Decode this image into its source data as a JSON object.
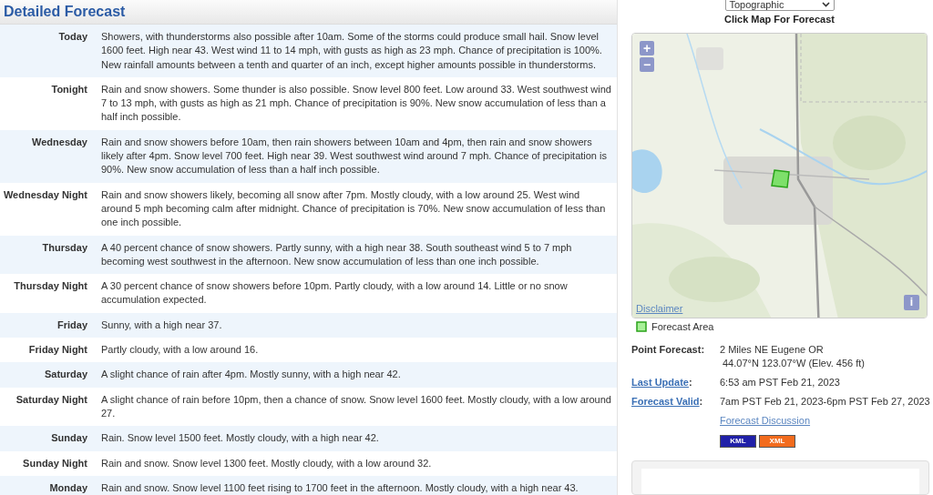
{
  "header": {
    "title": "Detailed Forecast"
  },
  "periods": [
    {
      "name": "Today",
      "text": "Showers, with thunderstorms also possible after 10am. Some of the storms could produce small hail. Snow level 1600 feet. High near 43. West wind 11 to 14 mph, with gusts as high as 23 mph. Chance of precipitation is 100%. New rainfall amounts between a tenth and quarter of an inch, except higher amounts possible in thunderstorms."
    },
    {
      "name": "Tonight",
      "text": "Rain and snow showers. Some thunder is also possible. Snow level 800 feet. Low around 33. West southwest wind 7 to 13 mph, with gusts as high as 21 mph. Chance of precipitation is 90%. New snow accumulation of less than a half inch possible."
    },
    {
      "name": "Wednesday",
      "text": "Rain and snow showers before 10am, then rain showers between 10am and 4pm, then rain and snow showers likely after 4pm. Snow level 700 feet. High near 39. West southwest wind around 7 mph. Chance of precipitation is 90%. New snow accumulation of less than a half inch possible."
    },
    {
      "name": "Wednesday Night",
      "text": "Rain and snow showers likely, becoming all snow after 7pm. Mostly cloudy, with a low around 25. West wind around 5 mph becoming calm after midnight. Chance of precipitation is 70%. New snow accumulation of less than one inch possible."
    },
    {
      "name": "Thursday",
      "text": "A 40 percent chance of snow showers. Partly sunny, with a high near 38. South southeast wind 5 to 7 mph becoming west southwest in the afternoon. New snow accumulation of less than one inch possible."
    },
    {
      "name": "Thursday Night",
      "text": "A 30 percent chance of snow showers before 10pm. Partly cloudy, with a low around 14. Little or no snow accumulation expected."
    },
    {
      "name": "Friday",
      "text": "Sunny, with a high near 37."
    },
    {
      "name": "Friday Night",
      "text": "Partly cloudy, with a low around 16."
    },
    {
      "name": "Saturday",
      "text": "A slight chance of rain after 4pm. Mostly sunny, with a high near 42."
    },
    {
      "name": "Saturday Night",
      "text": "A slight chance of rain before 10pm, then a chance of snow. Snow level 1600 feet. Mostly cloudy, with a low around 27."
    },
    {
      "name": "Sunday",
      "text": "Rain. Snow level 1500 feet. Mostly cloudy, with a high near 42."
    },
    {
      "name": "Sunday Night",
      "text": "Rain and snow. Snow level 1300 feet. Mostly cloudy, with a low around 32."
    },
    {
      "name": "Monday",
      "text": "Rain and snow. Snow level 1100 feet rising to 1700 feet in the afternoon. Mostly cloudy, with a high near 43."
    }
  ],
  "map_panel": {
    "layer_select": {
      "value": "Topographic"
    },
    "caption": "Click Map For Forecast",
    "zoom_buttons": [
      "+",
      "−"
    ],
    "disclaimer": "Disclaimer",
    "info_button": "i",
    "legend": "Forecast Area"
  },
  "details": [
    {
      "label": "Point Forecast:",
      "link": false,
      "lines": [
        "2 Miles NE Eugene OR",
        "44.07°N 123.07°W (Elev. 456 ft)"
      ]
    },
    {
      "label": "Last Update",
      "suffix": ":",
      "link": true,
      "lines": [
        "6:53 am PST Feb 21, 2023"
      ]
    },
    {
      "label": "Forecast Valid",
      "suffix": ":",
      "link": true,
      "lines": [
        "7am PST Feb 21, 2023-6pm PST Feb 27, 2023"
      ]
    }
  ],
  "discussion_link": "Forecast Discussion",
  "feeds": [
    {
      "label": "KML",
      "color": "#2020a8"
    },
    {
      "label": "XML",
      "color": "#f26b1d"
    }
  ]
}
